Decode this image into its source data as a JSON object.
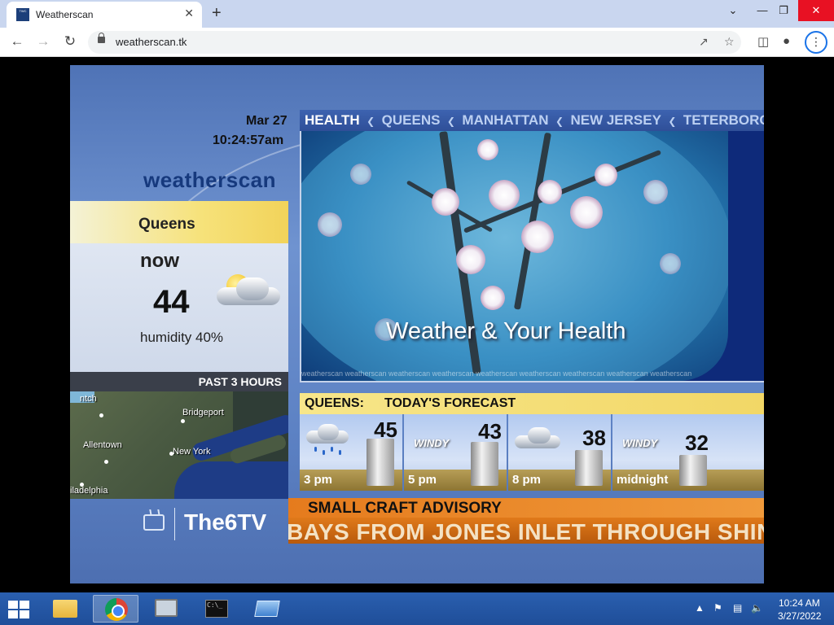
{
  "browser": {
    "tab_title": "Weatherscan",
    "favicon_text": "The Weather Channel",
    "new_tab": "+",
    "close_tab": "✕",
    "url": "weatherscan.tk",
    "window_controls": {
      "minimize": "—",
      "maximize": "❐",
      "close": "✕",
      "dropdown": "⌄"
    }
  },
  "weatherscan": {
    "date": "Mar 27",
    "time": "10:24:57am",
    "logo": "weatherscan",
    "city": "Queens",
    "now_label": "now",
    "current_temp": "44",
    "humidity": "humidity 40%",
    "past_hours": "PAST 3 HOURS",
    "radar_labels": [
      "ntch",
      "Bridgeport",
      "Allentown",
      "New York",
      "iladelphia"
    ],
    "channel": "The6TV",
    "crawl_items": [
      "HEALTH",
      "QUEENS",
      "MANHATTAN",
      "NEW JERSEY",
      "TETERBORO"
    ],
    "panel_title": "Weather & Your Health",
    "watermark": "weatherscan weatherscan weatherscan weatherscan weatherscan weatherscan weatherscan weatherscan weatherscan",
    "forecast": {
      "city": "QUEENS:",
      "title": "TODAY'S FORECAST",
      "periods": [
        {
          "time": "3 pm",
          "temp": "45",
          "icon": "rain-cloud-icon",
          "label": ""
        },
        {
          "time": "5 pm",
          "temp": "43",
          "icon": "windy-icon",
          "label": "WINDY"
        },
        {
          "time": "8 pm",
          "temp": "38",
          "icon": "cloud-icon",
          "label": ""
        },
        {
          "time": "midnight",
          "temp": "32",
          "icon": "windy-icon",
          "label": "WINDY"
        }
      ]
    },
    "advisory_title": "SMALL CRAFT ADVISORY",
    "advisory_text": "BAYS FROM JONES INLET THROUGH SHIN"
  },
  "taskbar": {
    "clock_time": "10:24 AM",
    "clock_date": "3/27/2022",
    "cmd_text": "C:\\_"
  },
  "colors": {
    "stage_blue": "#5d82c4",
    "city_yellow": "#f6e27a",
    "advisory_orange": "#e57b1d",
    "taskbar_blue": "#1f4e99"
  }
}
